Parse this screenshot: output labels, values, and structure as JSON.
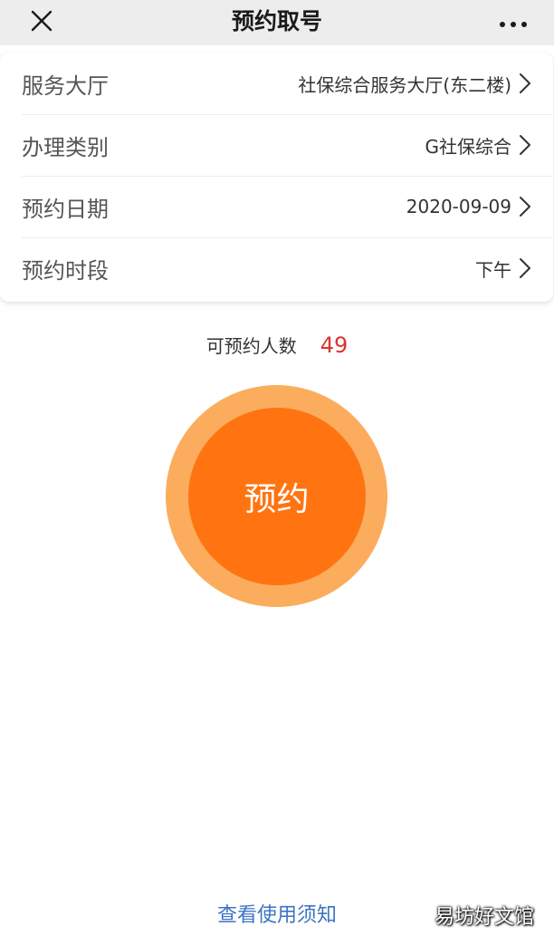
{
  "header": {
    "title": "预约取号"
  },
  "form": {
    "rows": [
      {
        "label": "服务大厅",
        "value": "社保综合服务大厅(东二楼)"
      },
      {
        "label": "办理类别",
        "value": "G社保综合"
      },
      {
        "label": "预约日期",
        "value": "2020-09-09"
      },
      {
        "label": "预约时段",
        "value": "下午"
      }
    ]
  },
  "quota": {
    "label": "可预约人数",
    "count": "49"
  },
  "action": {
    "book_label": "预约"
  },
  "footer": {
    "notice_link": "查看使用须知",
    "watermark": "易坊好文馆"
  },
  "colors": {
    "accent": "#ff7411",
    "accent_ring": "#fbad5d",
    "count": "#d9342b",
    "link": "#3d74c4"
  },
  "icons": {
    "close": "close-icon",
    "more": "more-icon",
    "chevron": "chevron-right-icon"
  }
}
